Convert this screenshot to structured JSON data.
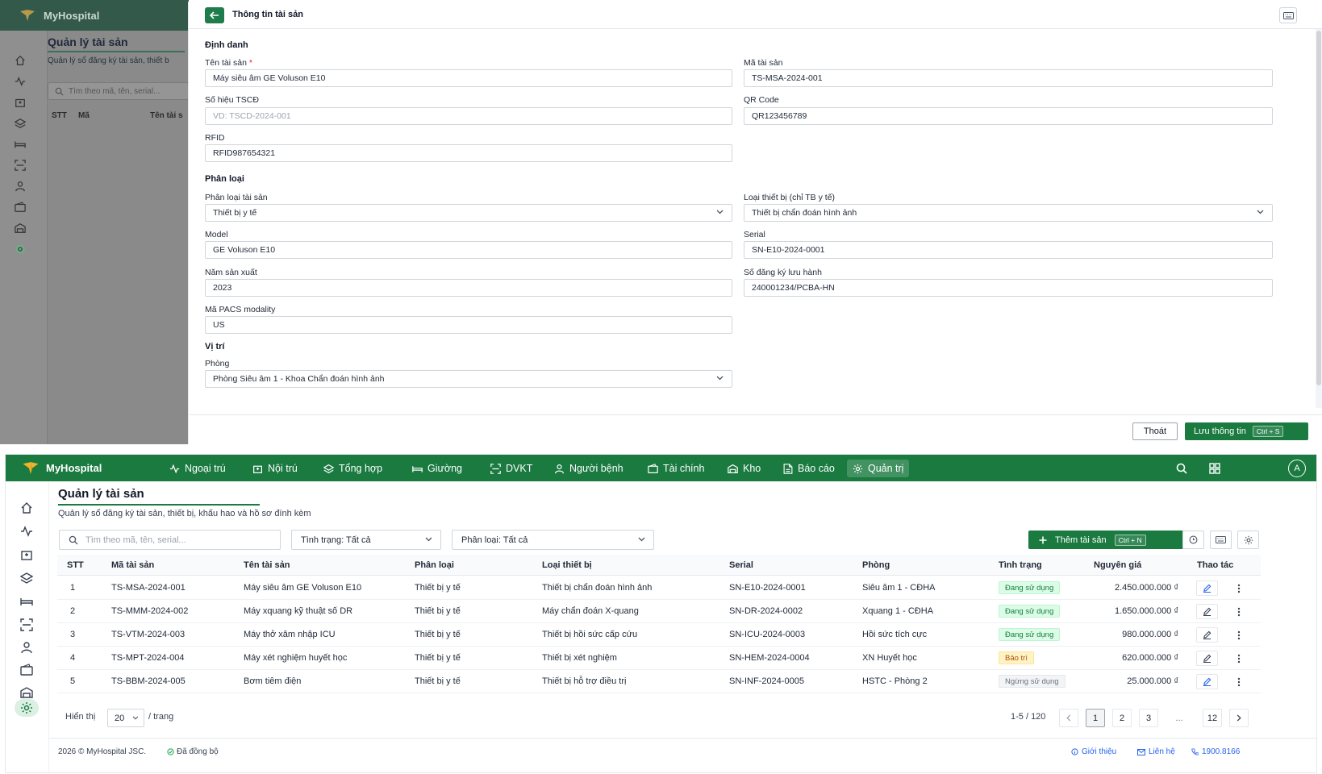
{
  "app": {
    "brand": "MyHospital"
  },
  "colors": {
    "primary": "#1a7a40",
    "overlay_header": "#33594a",
    "link": "#2563eb",
    "required": "#dc2626"
  },
  "background_page": {
    "title": "Quản lý tài sản",
    "subtitle": "Quản lý sổ đăng ký tài sản, thiết b",
    "search_placeholder": "Tìm theo mã, tên, serial...",
    "col_stt": "STT",
    "col_code": "Mã",
    "col_name": "Tên tài s"
  },
  "modal": {
    "title": "Thông tin tài sản",
    "back_icon": "arrow-left-icon",
    "keyboard_icon": "keyboard-icon",
    "sections": {
      "identity": "Định danh",
      "classification": "Phân loại",
      "location": "Vị trí"
    },
    "fields": {
      "asset_name": {
        "label": "Tên tài sản",
        "required_mark": "*",
        "value": "Máy siêu âm GE Voluson E10"
      },
      "asset_code": {
        "label": "Mã tài sản",
        "value": "TS-MSA-2024-001"
      },
      "fixed_asset_no": {
        "label": "Số hiệu TSCĐ",
        "placeholder": "VD: TSCD-2024-001"
      },
      "qr_code": {
        "label": "QR Code",
        "value": "QR123456789"
      },
      "rfid": {
        "label": "RFID",
        "value": "RFID987654321"
      },
      "asset_category": {
        "label": "Phân loại tài sản",
        "value": "Thiết bị y tế"
      },
      "device_type": {
        "label": "Loại thiết bị (chỉ TB y tế)",
        "value": "Thiết bị chẩn đoán hình ảnh"
      },
      "model": {
        "label": "Model",
        "value": "GE Voluson E10"
      },
      "serial": {
        "label": "Serial",
        "value": "SN-E10-2024-0001"
      },
      "manufacture_year": {
        "label": "Năm sản xuất",
        "value": "2023"
      },
      "registration_no": {
        "label": "Số đăng ký lưu hành",
        "value": "240001234/PCBA-HN"
      },
      "pacs_modality": {
        "label": "Mã PACS modality",
        "value": "US"
      },
      "room": {
        "label": "Phòng",
        "value": "Phòng Siêu âm 1 - Khoa Chẩn đoán hình ảnh"
      }
    },
    "exit_label": "Thoát",
    "save_label": "Lưu thông tin",
    "save_shortcut": "Ctrl + S"
  },
  "nav": {
    "items": [
      {
        "label": "Ngoại trú",
        "icon": "activity-icon"
      },
      {
        "label": "Nội trú",
        "icon": "hospital-icon"
      },
      {
        "label": "Tổng hợp",
        "icon": "layers-icon"
      },
      {
        "label": "Giường",
        "icon": "bed-icon"
      },
      {
        "label": "DVKT",
        "icon": "scan-icon"
      },
      {
        "label": "Người bệnh",
        "icon": "user-icon"
      },
      {
        "label": "Tài chính",
        "icon": "wallet-icon"
      },
      {
        "label": "Kho",
        "icon": "warehouse-icon"
      },
      {
        "label": "Báo cáo",
        "icon": "report-icon"
      },
      {
        "label": "Quản trị",
        "icon": "gear-icon",
        "active": true
      }
    ],
    "avatar": "A"
  },
  "page": {
    "title": "Quản lý tài sản",
    "subtitle": "Quản lý sổ đăng ký tài sản, thiết bị, khấu hao và hồ sơ đính kèm",
    "search_placeholder": "Tìm theo mã, tên, serial...",
    "filter_status": "Tình trạng: Tất cả",
    "filter_category": "Phân loại: Tất cả",
    "add_label": "Thêm tài sản",
    "add_shortcut": "Ctrl + N"
  },
  "table": {
    "columns": [
      "STT",
      "Mã tài sản",
      "Tên tài sản",
      "Phân loại",
      "Loại thiết bị",
      "Serial",
      "Phòng",
      "Tình trạng",
      "Nguyên giá",
      "Thao tác"
    ],
    "rows": [
      {
        "stt": "1",
        "code": "TS-MSA-2024-001",
        "name": "Máy siêu âm GE Voluson E10",
        "category": "Thiết bị y tế",
        "type": "Thiết bị chẩn đoán hình ảnh",
        "serial": "SN-E10-2024-0001",
        "room": "Siêu âm 1 - CĐHA",
        "status": "Đang sử dụng",
        "status_kind": "ok",
        "price": "2.450.000.000 ₫"
      },
      {
        "stt": "2",
        "code": "TS-MMM-2024-002",
        "name": "Máy xquang kỹ thuật số DR",
        "category": "Thiết bị y tế",
        "type": "Máy chẩn đoán X-quang",
        "serial": "SN-DR-2024-0002",
        "room": "Xquang 1 - CĐHA",
        "status": "Đang sử dụng",
        "status_kind": "ok",
        "price": "1.650.000.000 ₫"
      },
      {
        "stt": "3",
        "code": "TS-VTM-2024-003",
        "name": "Máy thở xâm nhập ICU",
        "category": "Thiết bị y tế",
        "type": "Thiết bị hồi sức cấp cứu",
        "serial": "SN-ICU-2024-0003",
        "room": "Hồi sức tích cực",
        "status": "Đang sử dụng",
        "status_kind": "ok",
        "price": "980.000.000 ₫"
      },
      {
        "stt": "4",
        "code": "TS-MPT-2024-004",
        "name": "Máy xét nghiệm huyết học",
        "category": "Thiết bị y tế",
        "type": "Thiết bị xét nghiệm",
        "serial": "SN-HEM-2024-0004",
        "room": "XN Huyết học",
        "status": "Bảo trì",
        "status_kind": "warn",
        "price": "620.000.000 ₫"
      },
      {
        "stt": "5",
        "code": "TS-BBM-2024-005",
        "name": "Bơm tiêm điện",
        "category": "Thiết bị y tế",
        "type": "Thiết bị hỗ trợ điều trị",
        "serial": "SN-INF-2024-0005",
        "room": "HSTC - Phòng 2",
        "status": "Ngừng sử dụng",
        "status_kind": "off",
        "price": "25.000.000 ₫"
      }
    ]
  },
  "pagination": {
    "show_label": "Hiển thị",
    "page_size": "20",
    "per_page_label": "/ trang",
    "range": "1-5 / 120",
    "pages": [
      "1",
      "2",
      "3",
      "...",
      "12"
    ],
    "current": "1"
  },
  "footer": {
    "copyright": "2026 © MyHospital JSC.",
    "sync_status": "Đã đồng bộ",
    "intro": "Giới thiệu",
    "contact": "Liên hệ",
    "hotline": "1900.8166"
  }
}
